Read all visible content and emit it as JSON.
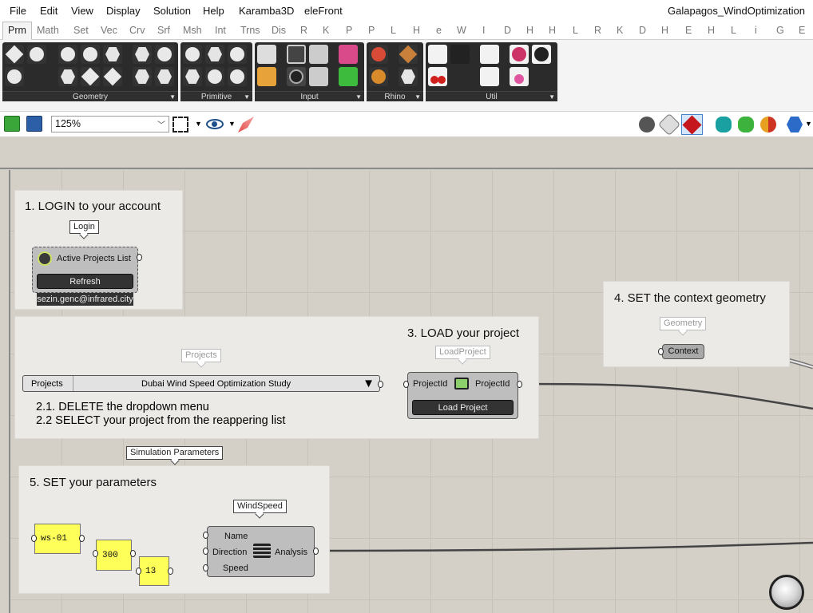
{
  "menu": [
    "File",
    "Edit",
    "View",
    "Display",
    "Solution",
    "Help",
    "Karamba3D",
    "eleFront"
  ],
  "window_title": "Galapagos_WindOptimization",
  "tabs": [
    "Prm",
    "Math",
    "Set",
    "Vec",
    "Crv",
    "Srf",
    "Msh",
    "Int",
    "Trns",
    "Dis",
    "R",
    "K",
    "P",
    "P",
    "L",
    "H",
    "e",
    "W",
    "I",
    "D",
    "H",
    "H",
    "L",
    "R",
    "K",
    "D",
    "H",
    "E",
    "H",
    "L",
    "i",
    "G",
    "E"
  ],
  "ribbon_panels": [
    "Geometry",
    "Primitive",
    "Input",
    "Rhino",
    "Util"
  ],
  "toolbar": {
    "zoom": "125%"
  },
  "groups": {
    "login": {
      "title": "1. LOGIN to your account",
      "callout": "Login",
      "component": "Active Projects List",
      "button": "Refresh",
      "user": "sezin.genc@infrared.city"
    },
    "projects": {
      "callout": "Projects",
      "dropdown_label": "Projects",
      "dropdown_value": "Dubai Wind Speed Optimization Study",
      "note1": "2.1. DELETE the dropdown menu",
      "note2": "2.2 SELECT your project from the reappering list"
    },
    "load": {
      "title": "3. LOAD your project",
      "callout": "LoadProject",
      "input": "ProjectId",
      "output": "ProjectId",
      "button": "Load Project"
    },
    "context": {
      "title": "4. SET the context geometry",
      "callout": "Geometry",
      "param": "Context"
    },
    "params": {
      "outer_callout": "Simulation Parameters",
      "title": "5. SET your parameters",
      "callout": "WindSpeed",
      "panel1": "ws-01",
      "panel2": "300",
      "panel3": "13",
      "in_name": "Name",
      "in_direction": "Direction",
      "in_speed": "Speed",
      "output": "Analysis"
    }
  }
}
